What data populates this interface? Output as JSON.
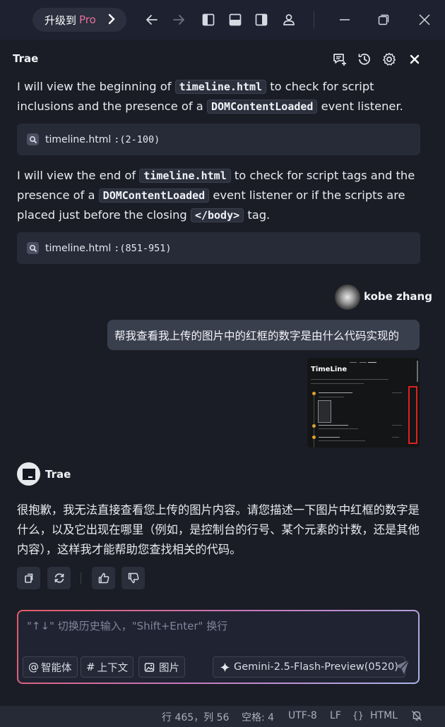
{
  "topbar": {
    "upgrade_prefix": "升级到",
    "upgrade_pro": "Pro",
    "icons": [
      "back-arrow-icon",
      "forward-arrow-icon",
      "left-panel-icon",
      "bottom-panel-icon",
      "right-panel-icon",
      "account-icon",
      "minimize-icon",
      "restore-icon",
      "close-icon"
    ]
  },
  "panel": {
    "title": "Trae"
  },
  "messages": {
    "p1_a": "I will view the beginning of ",
    "p1_code": "timeline.html",
    "p1_b": " to check for script inclusions and the presence of a ",
    "p1_code2": "DOMContentLoaded",
    "p1_c": " event listener.",
    "file1_name": "timeline.html",
    "file1_range": ":(2-100)",
    "p2_a": "I will view the end of ",
    "p2_code": "timeline.html",
    "p2_b": " to check for script tags and the presence of a ",
    "p2_code2": "DOMContentLoaded",
    "p2_c": " event listener or if the scripts are placed just before the closing ",
    "p2_code3": "</body>",
    "p2_d": " tag.",
    "file2_name": "timeline.html",
    "file2_range": ":(851-951)"
  },
  "user": {
    "name": "kobe zhang",
    "message": "帮我查看我上传的图片中的红框的数字是由什么代码实现的",
    "thumb_title": "TimeLine"
  },
  "reply": {
    "name": "Trae",
    "text": "很抱歉，我无法直接查看您上传的图片内容。请您描述一下图片中红框的数字是什么，以及它出现在哪里（例如，是控制台的行号、某个元素的计数，还是其他内容），这样我才能帮助您查找相关的代码。"
  },
  "input": {
    "placeholder": "\"↑↓\" 切换历史输入，\"Shift+Enter\" 换行",
    "agent_label": "智能体",
    "context_label": "上下文",
    "image_label": "图片",
    "model_label": "Gemini-2.5-Flash-Preview(0520)"
  },
  "statusbar": {
    "position": "行 465，列 56",
    "spaces": "空格: 4",
    "encoding": "UTF-8",
    "eol": "LF",
    "language": "HTML"
  }
}
